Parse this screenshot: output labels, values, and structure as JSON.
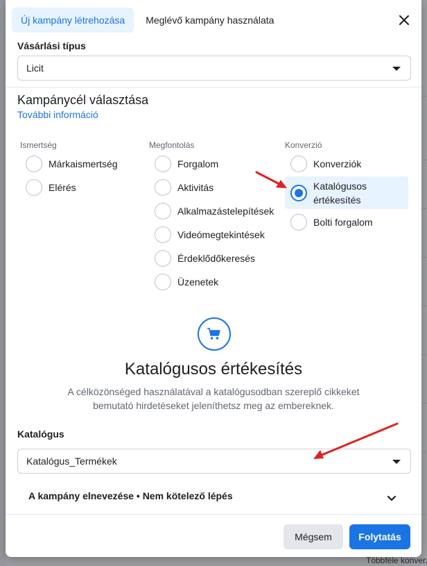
{
  "tabs": [
    {
      "label": "Új kampány létrehozása",
      "active": true
    },
    {
      "label": "Meglévő kampány használata",
      "active": false
    }
  ],
  "purchase_type": {
    "label": "Vásárlási típus",
    "value": "Licit"
  },
  "objective": {
    "title": "Kampánycél választása",
    "more_info": "További információ",
    "columns": [
      {
        "heading": "Ismertség",
        "options": [
          "Márkaismertség",
          "Elérés"
        ]
      },
      {
        "heading": "Megfontolás",
        "options": [
          "Forgalom",
          "Aktivitás",
          "Alkalmazástelepítések",
          "Videómegtekintések",
          "Érdeklődőkeresés",
          "Üzenetek"
        ]
      },
      {
        "heading": "Konverzió",
        "options": [
          "Konverziók",
          "Katalógusos értékesítés",
          "Bolti forgalom"
        ]
      }
    ],
    "selected_line1": "Katalógusos",
    "selected_line2": "értékesítés"
  },
  "selected_detail": {
    "icon": "shopping-cart-icon",
    "title": "Katalógusos értékesítés",
    "description": "A célközönséged használatával a katalógusodban szereplő cikkeket bemutató hirdetéseket jeleníthetsz meg az embereknek."
  },
  "catalog": {
    "label": "Katalógus",
    "value": "Katalógus_Termékek"
  },
  "campaign_name": {
    "label": "A kampány elnevezése • Nem kötelező lépés"
  },
  "buttons": {
    "cancel": "Mégsem",
    "continue": "Folytatás"
  },
  "background": {
    "bottom_text": "Többféle konverz"
  },
  "colors": {
    "accent": "#1b74e4",
    "selected_bg": "#e7f3ff",
    "arrow": "#e02020"
  }
}
